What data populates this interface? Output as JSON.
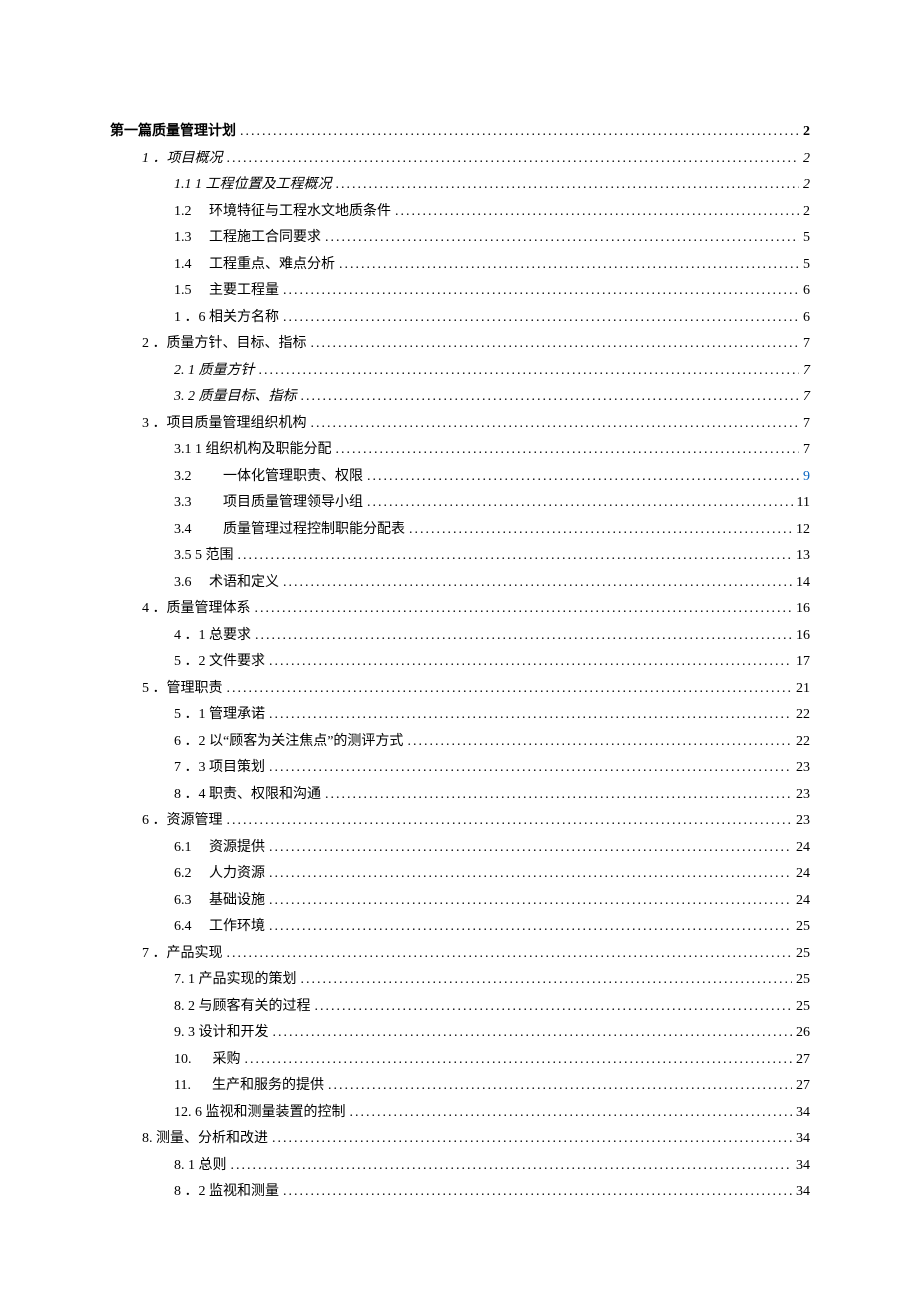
{
  "toc": [
    {
      "level": 0,
      "num": "",
      "title": "第一篇质量管理计划",
      "page": "2",
      "bold": true,
      "italic": false,
      "page_link": false
    },
    {
      "level": 1,
      "num": "1",
      "title": "．项目概况",
      "page": "2",
      "bold": false,
      "italic": true,
      "page_link": false
    },
    {
      "level": 2,
      "num": "1.1",
      "title": "1 工程位置及工程概况",
      "page": "2",
      "bold": false,
      "italic": true,
      "page_link": false
    },
    {
      "level": 2,
      "num": "1.2",
      "title": "　环境特征与工程水文地质条件",
      "page": "2",
      "bold": false,
      "italic": false,
      "page_link": false
    },
    {
      "level": 2,
      "num": "1.3",
      "title": "　工程施工合同要求",
      "page": "5",
      "bold": false,
      "italic": false,
      "page_link": false
    },
    {
      "level": 2,
      "num": "1.4",
      "title": "　工程重点、难点分析",
      "page": "5",
      "bold": false,
      "italic": false,
      "page_link": false
    },
    {
      "level": 2,
      "num": "1.5",
      "title": "　主要工程量",
      "page": "6",
      "bold": false,
      "italic": false,
      "page_link": false
    },
    {
      "level": 2,
      "num": "1",
      "title": "．6 相关方名称",
      "page": "6",
      "bold": false,
      "italic": false,
      "page_link": false
    },
    {
      "level": 1,
      "num": "2",
      "title": "．质量方针、目标、指标",
      "page": "7",
      "bold": false,
      "italic": false,
      "page_link": false
    },
    {
      "level": 2,
      "num": "2.",
      "title": "  1 质量方针",
      "page": "7",
      "bold": false,
      "italic": true,
      "page_link": false
    },
    {
      "level": 2,
      "num": "3.",
      "title": "  2 质量目标、指标",
      "page": "7",
      "bold": false,
      "italic": true,
      "page_link": false
    },
    {
      "level": 1,
      "num": "3",
      "title": "．项目质量管理组织机构",
      "page": "7",
      "bold": false,
      "italic": false,
      "page_link": false
    },
    {
      "level": 2,
      "num": "3.1",
      "title": "1 组织机构及职能分配",
      "page": "7",
      "bold": false,
      "italic": false,
      "page_link": false
    },
    {
      "level": 2,
      "num": "3.2",
      "title": "　　一体化管理职责、权限",
      "page": "9",
      "bold": false,
      "italic": false,
      "page_link": true
    },
    {
      "level": 2,
      "num": "3.3",
      "title": "　　项目质量管理领导小组",
      "page": "11",
      "bold": false,
      "italic": false,
      "page_link": false
    },
    {
      "level": 2,
      "num": "3.4",
      "title": "　　质量管理过程控制职能分配表",
      "page": "12",
      "bold": false,
      "italic": false,
      "page_link": false
    },
    {
      "level": 2,
      "num": "3.5",
      "title": "5 范围",
      "page": "13",
      "bold": false,
      "italic": false,
      "page_link": false
    },
    {
      "level": 2,
      "num": "3.6",
      "title": "　术语和定义",
      "page": "14",
      "bold": false,
      "italic": false,
      "page_link": false
    },
    {
      "level": 1,
      "num": "4",
      "title": "．质量管理体系",
      "page": "16",
      "bold": false,
      "italic": false,
      "page_link": false
    },
    {
      "level": 2,
      "num": "4",
      "title": "．1 总要求",
      "page": "16",
      "bold": false,
      "italic": false,
      "page_link": false
    },
    {
      "level": 2,
      "num": "5",
      "title": "．2 文件要求",
      "page": "17",
      "bold": false,
      "italic": false,
      "page_link": false
    },
    {
      "level": 1,
      "num": "5",
      "title": "．管理职责",
      "page": "21",
      "bold": false,
      "italic": false,
      "page_link": false
    },
    {
      "level": 2,
      "num": "5",
      "title": "．1 管理承诺",
      "page": "22",
      "bold": false,
      "italic": false,
      "page_link": false
    },
    {
      "level": 2,
      "num": "6",
      "title": "．2 以“顾客为关注焦点”的测评方式",
      "page": "22",
      "bold": false,
      "italic": false,
      "page_link": false
    },
    {
      "level": 2,
      "num": "7",
      "title": "．3 项目策划",
      "page": "23",
      "bold": false,
      "italic": false,
      "page_link": false
    },
    {
      "level": 2,
      "num": "8",
      "title": "．4 职责、权限和沟通",
      "page": "23",
      "bold": false,
      "italic": false,
      "page_link": false
    },
    {
      "level": 1,
      "num": "6",
      "title": "．资源管理",
      "page": "23",
      "bold": false,
      "italic": false,
      "page_link": false
    },
    {
      "level": 2,
      "num": "6.1",
      "title": "　资源提供",
      "page": "24",
      "bold": false,
      "italic": false,
      "page_link": false
    },
    {
      "level": 2,
      "num": "6.2",
      "title": "　人力资源",
      "page": "24",
      "bold": false,
      "italic": false,
      "page_link": false
    },
    {
      "level": 2,
      "num": "6.3",
      "title": "　基础设施",
      "page": "24",
      "bold": false,
      "italic": false,
      "page_link": false
    },
    {
      "level": 2,
      "num": "6.4",
      "title": "　工作环境",
      "page": "25",
      "bold": false,
      "italic": false,
      "page_link": false
    },
    {
      "level": 1,
      "num": "7",
      "title": "．产品实现",
      "page": "25",
      "bold": false,
      "italic": false,
      "page_link": false
    },
    {
      "level": 2,
      "num": "7.",
      "title": "  1 产品实现的策划",
      "page": "25",
      "bold": false,
      "italic": false,
      "page_link": false
    },
    {
      "level": 2,
      "num": "8.",
      "title": "  2 与顾客有关的过程",
      "page": "25",
      "bold": false,
      "italic": false,
      "page_link": false
    },
    {
      "level": 2,
      "num": "9.",
      "title": "  3 设计和开发",
      "page": "26",
      "bold": false,
      "italic": false,
      "page_link": false
    },
    {
      "level": 2,
      "num": "10.",
      "title": "　 采购",
      "page": "27",
      "bold": false,
      "italic": false,
      "page_link": false
    },
    {
      "level": 2,
      "num": "11.",
      "title": "　 生产和服务的提供",
      "page": "27",
      "bold": false,
      "italic": false,
      "page_link": false
    },
    {
      "level": 2,
      "num": "12.",
      "title": "6 监视和测量装置的控制",
      "page": "34",
      "bold": false,
      "italic": false,
      "page_link": false
    },
    {
      "level": 1,
      "num": "8.",
      "title": "测量、分析和改进",
      "page": "34",
      "bold": false,
      "italic": false,
      "page_link": false
    },
    {
      "level": 2,
      "num": "8.",
      "title": "  1 总则",
      "page": "34",
      "bold": false,
      "italic": false,
      "page_link": false
    },
    {
      "level": 2,
      "num": "8",
      "title": "．2 监视和测量",
      "page": "34",
      "bold": false,
      "italic": false,
      "page_link": false
    }
  ]
}
